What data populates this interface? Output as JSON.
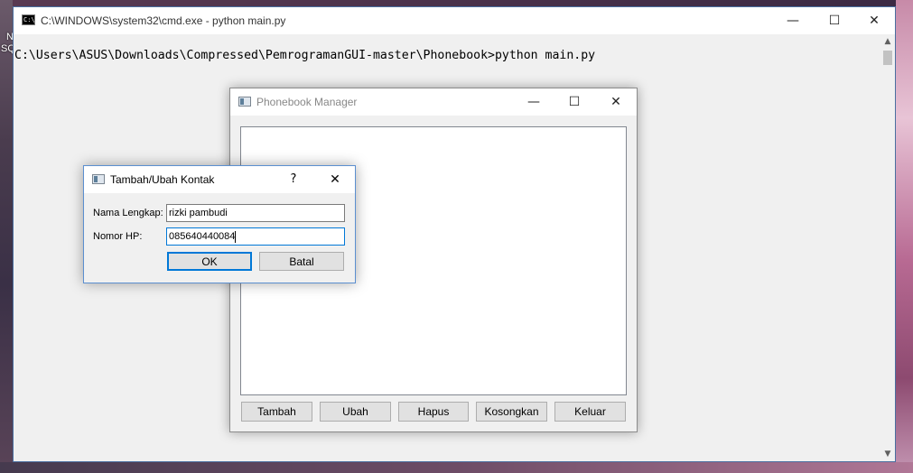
{
  "desktop": {
    "labels": [
      "N",
      "SQ"
    ]
  },
  "cmd_window": {
    "title": "C:\\WINDOWS\\system32\\cmd.exe - python  main.py",
    "icon_text": "C:\\",
    "minimize_glyph": "—",
    "maximize_glyph": "☐",
    "close_glyph": "✕",
    "prompt_line": "C:\\Users\\ASUS\\Downloads\\Compressed\\PemrogramanGUI-master\\Phonebook>python main.py",
    "scroll_up_glyph": "▲",
    "scroll_down_glyph": "▼"
  },
  "phonebook_window": {
    "title": "Phonebook Manager",
    "minimize_glyph": "—",
    "maximize_glyph": "☐",
    "close_glyph": "✕",
    "buttons": {
      "add": "Tambah",
      "edit": "Ubah",
      "delete": "Hapus",
      "clear": "Kosongkan",
      "exit": "Keluar"
    }
  },
  "contact_dialog": {
    "title": "Tambah/Ubah Kontak",
    "help_glyph": "?",
    "close_glyph": "✕",
    "name_label": "Nama Lengkap:",
    "name_value": "rizki pambudi",
    "phone_label": "Nomor HP:",
    "phone_value": "085640440084",
    "ok_label": "OK",
    "cancel_label": "Batal"
  },
  "colors": {
    "focus_accent": "#0078d7",
    "console_bg": "#f0f0f0"
  }
}
